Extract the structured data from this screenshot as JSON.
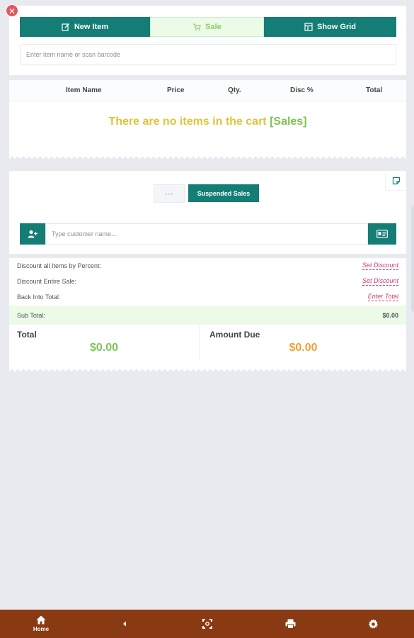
{
  "toolbar": {
    "new_item_label": "New Item",
    "sale_label": "Sale",
    "show_grid_label": "Show Grid",
    "scan_placeholder": "Enter item name or scan barcode"
  },
  "cart": {
    "columns": [
      "Item Name",
      "Price",
      "Qty.",
      "Disc %",
      "Total"
    ],
    "empty_message": "There are no items in the cart",
    "empty_tag": "[Sales]"
  },
  "customer": {
    "more_label": "···",
    "suspended_sales_label": "Suspended Sales",
    "customer_placeholder": "Type customer name..."
  },
  "totals": {
    "discount_percent_label": "Discount all Items by Percent:",
    "discount_percent_action": "Set Discount",
    "discount_sale_label": "Discount Entire Sale:",
    "discount_sale_action": "Set Discount",
    "back_into_label": "Back Into Total:",
    "back_into_action": "Enter Total",
    "subtotal_label": "Sub Total:",
    "subtotal_value": "$0.00",
    "total_label": "Total",
    "total_value": "$0.00",
    "amount_due_label": "Amount Due",
    "amount_due_value": "$0.00"
  },
  "nav": {
    "home_label": "Home"
  },
  "colors": {
    "teal": "#147d76",
    "bottom_bar": "#8a3a13",
    "total_green": "#7cc452",
    "amount_due_orange": "#f0a035",
    "empty_yellow": "#e0c43c",
    "link_pink": "#cc3b6a"
  }
}
